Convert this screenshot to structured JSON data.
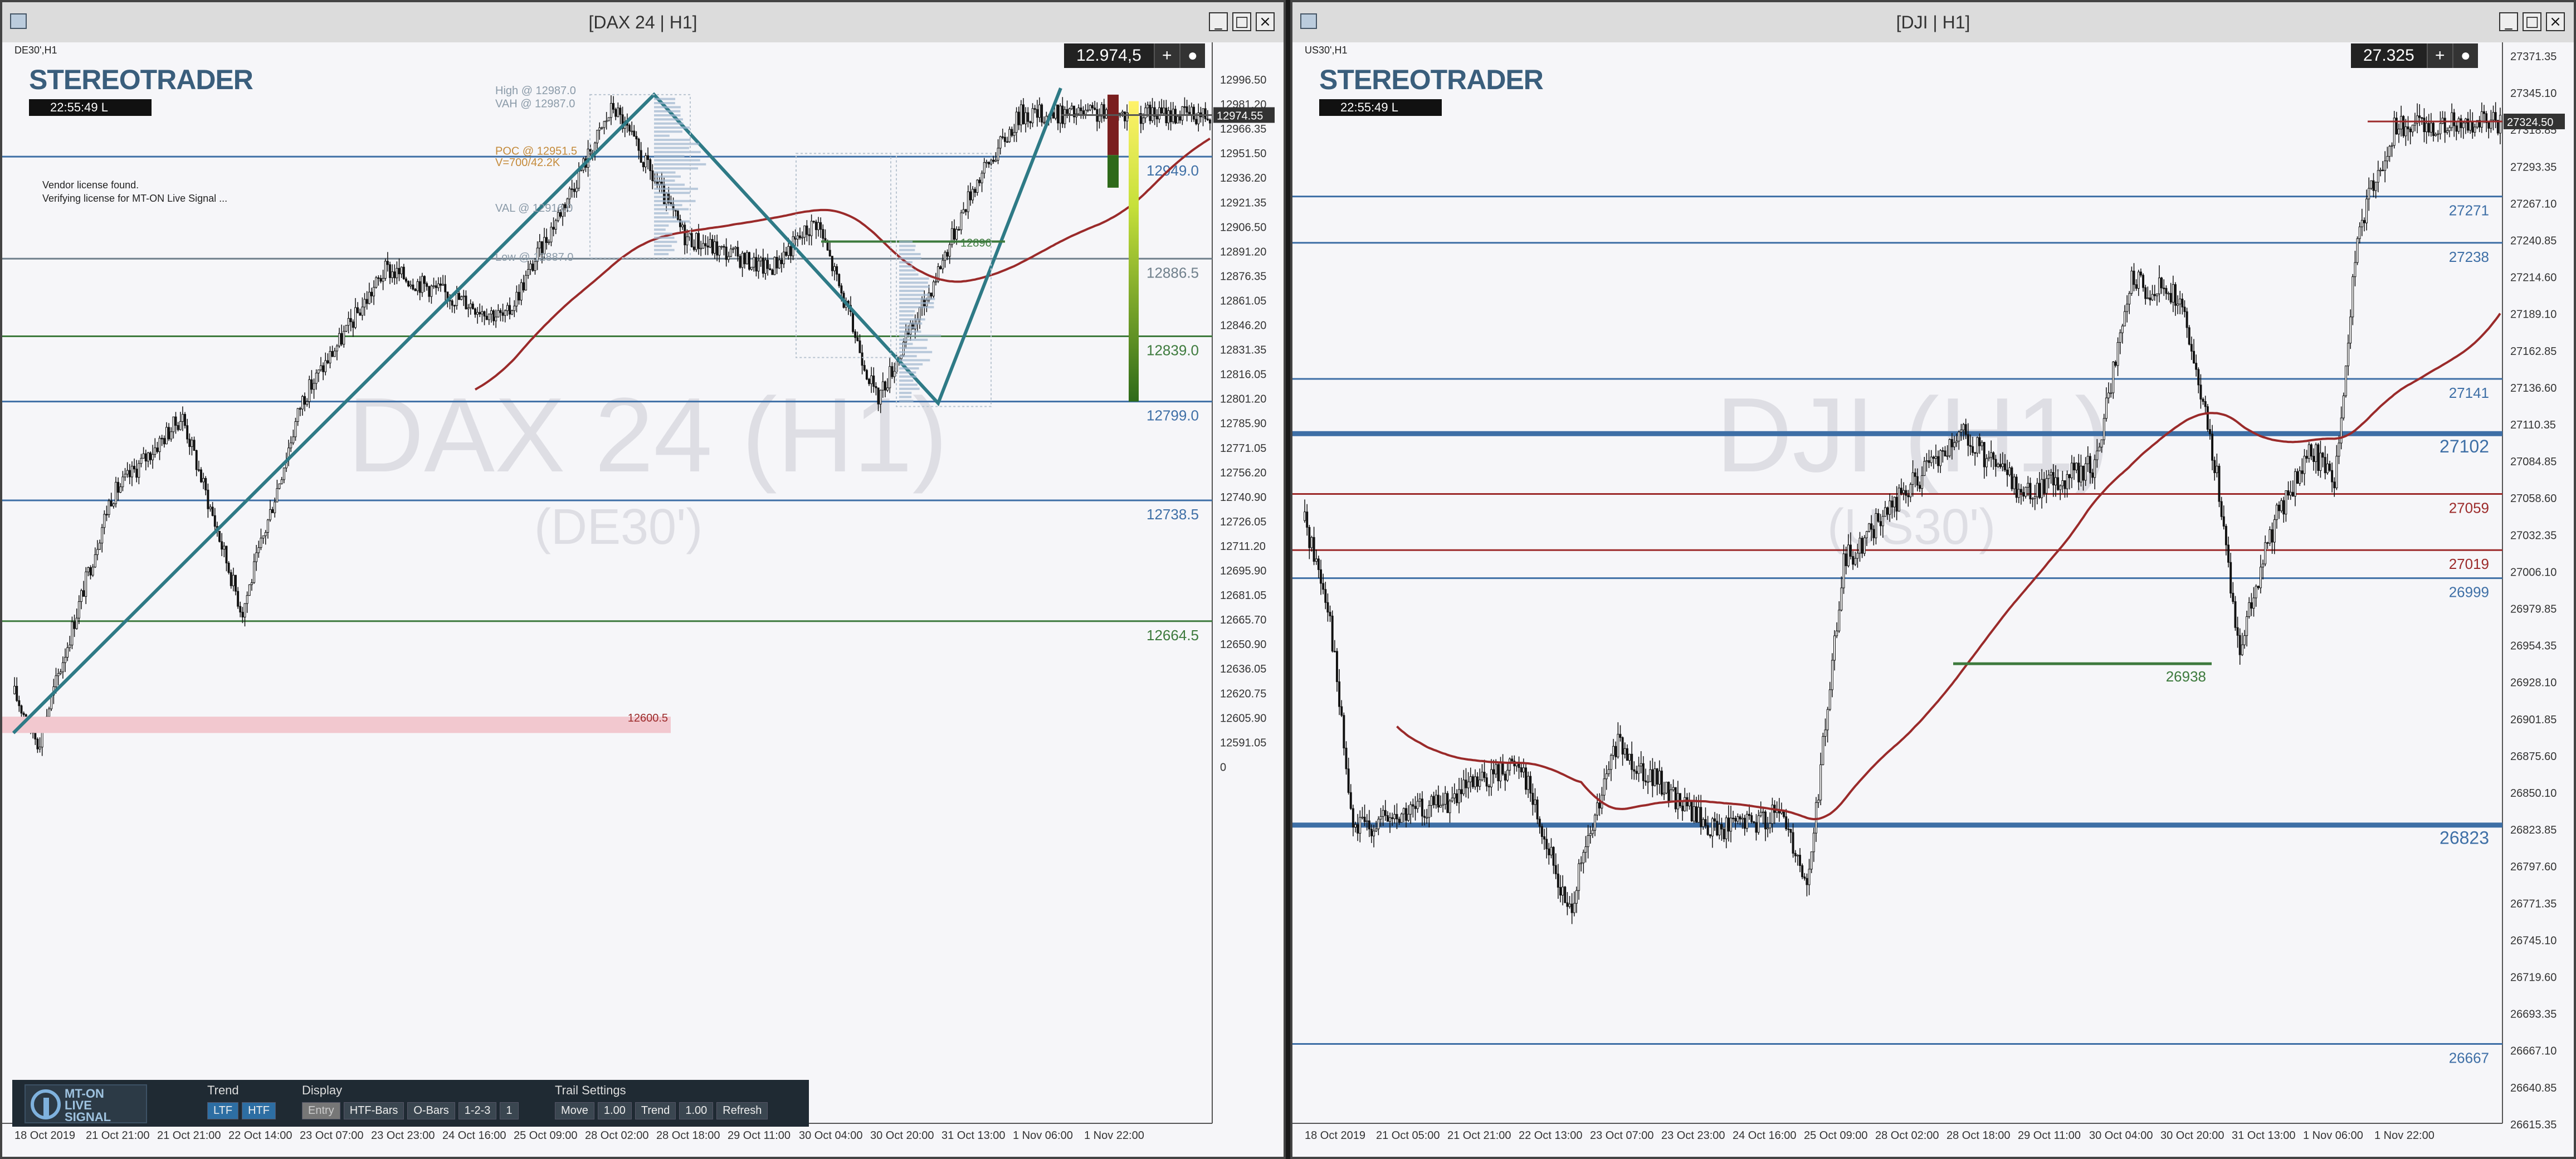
{
  "windows": [
    {
      "title": "[DAX 24 | H1]",
      "symbol_label": "DE30',H1",
      "current_price": "12.974,5",
      "logo_text": "STEREOTRADER",
      "clock": "22:55:49 L",
      "info_lines": [
        "Vendor license found.",
        "Verifying license for MT-ON Live Signal ..."
      ],
      "watermark": "DAX 24 (H1)",
      "watermark_sub": "(DE30')",
      "y_axis": [
        "12996.50",
        "12981.20",
        "12966.35",
        "12951.50",
        "12936.20",
        "12921.35",
        "12906.50",
        "12891.20",
        "12876.35",
        "12861.05",
        "12846.20",
        "12831.35",
        "12816.05",
        "12801.20",
        "12785.90",
        "12771.05",
        "12756.20",
        "12740.90",
        "12726.05",
        "12711.20",
        "12695.90",
        "12681.05",
        "12665.70",
        "12650.90",
        "12636.05",
        "12620.75",
        "12605.90",
        "12591.05",
        "0"
      ],
      "current_price_tag": "12974.55",
      "x_axis": [
        "18 Oct 2019",
        "21 Oct 21:00",
        "21 Oct 21:00",
        "22 Oct 14:00",
        "23 Oct 07:00",
        "23 Oct 23:00",
        "24 Oct 16:00",
        "25 Oct 09:00",
        "28 Oct 02:00",
        "28 Oct 18:00",
        "29 Oct 11:00",
        "30 Oct 04:00",
        "30 Oct 20:00",
        "31 Oct 13:00",
        "1 Nov 06:00",
        "1 Nov 22:00"
      ],
      "levels": [
        {
          "label": "12949.0",
          "price": 12949.0,
          "color": "#3e6fa6",
          "weight": "thin"
        },
        {
          "label": "12886.5",
          "price": 12886.5,
          "color": "#70808c",
          "weight": "thin"
        },
        {
          "label": "12839.0",
          "price": 12839.0,
          "color": "#3d7a3d",
          "weight": "thin"
        },
        {
          "label": "12799.0",
          "price": 12799.0,
          "color": "#3e6fa6",
          "weight": "thin"
        },
        {
          "label": "12738.5",
          "price": 12738.5,
          "color": "#3e6fa6",
          "weight": "thin"
        },
        {
          "label": "12664.5",
          "price": 12664.5,
          "color": "#3d7a3d",
          "weight": "thin"
        }
      ],
      "zone_label": "12600.5",
      "profile_labels": {
        "high": "High @ 12987.0",
        "vah": "VAH @ 12987.0",
        "poc": "POC @ 12951.5",
        "vol": "V=700/42.2K",
        "val": "VAL @ 12916.0",
        "low": "Low @ 12887.0",
        "mid": "12896"
      },
      "toolbar": {
        "brand": [
          "MT-ON",
          "LIVE",
          "SIGNAL"
        ],
        "trend": {
          "title": "Trend",
          "buttons": [
            "LTF",
            "HTF"
          ]
        },
        "display": {
          "title": "Display",
          "buttons": [
            "Entry",
            "HTF-Bars",
            "O-Bars",
            "1-2-3",
            "1"
          ]
        },
        "trail": {
          "title": "Trail Settings",
          "buttons": [
            "Move",
            "1.00",
            "Trend",
            "1.00",
            "Refresh"
          ]
        }
      }
    },
    {
      "title": "[DJI | H1]",
      "symbol_label": "US30',H1",
      "current_price": "27.325",
      "logo_text": "STEREOTRADER",
      "clock": "22:55:49 L",
      "watermark": "DJI (H1)",
      "watermark_sub": "(US30')",
      "y_axis": [
        "27371.35",
        "27345.10",
        "27318.85",
        "27293.35",
        "27267.10",
        "27240.85",
        "27214.60",
        "27189.10",
        "27162.85",
        "27136.60",
        "27110.35",
        "27084.85",
        "27058.60",
        "27032.35",
        "27006.10",
        "26979.85",
        "26954.35",
        "26928.10",
        "26901.85",
        "26875.60",
        "26850.10",
        "26823.85",
        "26797.60",
        "26771.35",
        "26745.10",
        "26719.60",
        "26693.35",
        "26667.10",
        "26640.85",
        "26615.35"
      ],
      "current_price_tag": "27324.50",
      "x_axis": [
        "18 Oct 2019",
        "21 Oct 05:00",
        "21 Oct 21:00",
        "22 Oct 13:00",
        "23 Oct 07:00",
        "23 Oct 23:00",
        "24 Oct 16:00",
        "25 Oct 09:00",
        "28 Oct 02:00",
        "28 Oct 18:00",
        "29 Oct 11:00",
        "30 Oct 04:00",
        "30 Oct 20:00",
        "31 Oct 13:00",
        "1 Nov 06:00",
        "1 Nov 22:00"
      ],
      "levels": [
        {
          "label": "27271",
          "price": 27271,
          "color": "#3e6fa6",
          "weight": "thin"
        },
        {
          "label": "27238",
          "price": 27238,
          "color": "#3e6fa6",
          "weight": "thin"
        },
        {
          "label": "27141",
          "price": 27141,
          "color": "#3e6fa6",
          "weight": "thin"
        },
        {
          "label": "27102",
          "price": 27102,
          "color": "#3e6fa6",
          "weight": "thick"
        },
        {
          "label": "27059",
          "price": 27059,
          "color": "#9c2a2a",
          "weight": "thin"
        },
        {
          "label": "27019",
          "price": 27019,
          "color": "#9c2a2a",
          "weight": "thin"
        },
        {
          "label": "26999",
          "price": 26999,
          "color": "#3e6fa6",
          "weight": "thin"
        },
        {
          "label": "26823",
          "price": 26823,
          "color": "#3e6fa6",
          "weight": "thick"
        },
        {
          "label": "26667",
          "price": 26667,
          "color": "#3e6fa6",
          "weight": "thin"
        }
      ],
      "green_level_label": "26938"
    }
  ],
  "colors": {
    "ma": "#9a2a2a",
    "zigzag": "#2e7a86",
    "chart_bg": "#f6f6f9"
  }
}
